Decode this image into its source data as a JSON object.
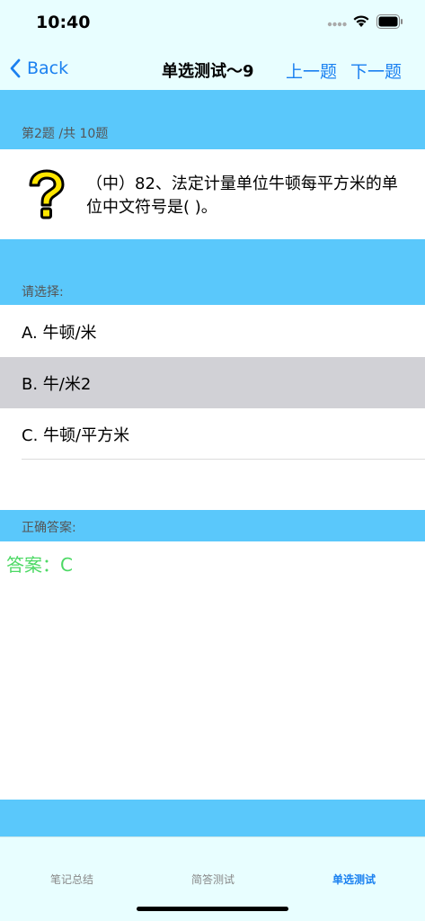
{
  "status_bar": {
    "time": "10:40"
  },
  "nav": {
    "back_label": "Back",
    "title": "单选测试～9",
    "prev_label": "上一题",
    "next_label": "下一题"
  },
  "question": {
    "progress": "第2题 /共 10题",
    "text": "（中）82、法定计量单位牛顿每平方米的单位中文符号是(     )。"
  },
  "options_section": {
    "label": "请选择:",
    "options": [
      {
        "label": "A. 牛顿/米",
        "selected": false
      },
      {
        "label": "B. 牛/米2",
        "selected": true
      },
      {
        "label": "C. 牛顿/平方米",
        "selected": false
      }
    ]
  },
  "answer_section": {
    "label": "正确答案:",
    "answer": "答案：C"
  },
  "tabs": [
    {
      "label": "笔记总结",
      "active": false
    },
    {
      "label": "简答测试",
      "active": false
    },
    {
      "label": "单选测试",
      "active": true
    }
  ],
  "colors": {
    "accent": "#1a80f0",
    "band": "#5ac8fb",
    "header_bg": "#e8feff",
    "answer": "#4cd964",
    "selected_row": "#d1d1d6"
  }
}
